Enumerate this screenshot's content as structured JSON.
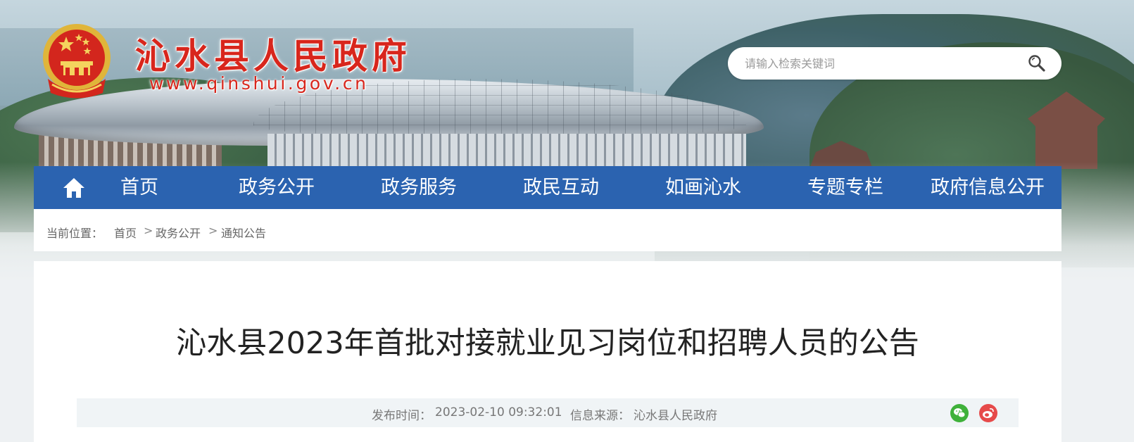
{
  "header": {
    "site_name": "沁水县人民政府",
    "site_url": "www.qinshui.gov.cn"
  },
  "search": {
    "placeholder": "请输入检索关键词",
    "value": ""
  },
  "nav": {
    "home_icon": "home-icon",
    "items": [
      "首页",
      "政务公开",
      "政务服务",
      "政民互动",
      "如画沁水",
      "专题专栏",
      "政府信息公开"
    ]
  },
  "breadcrumb": {
    "label": "当前位置：",
    "items": [
      "首页",
      "政务公开",
      "通知公告"
    ],
    "separator": ">"
  },
  "article": {
    "title": "沁水县2023年首批对接就业见习岗位和招聘人员的公告",
    "publish_label": "发布时间：",
    "publish_time": "2023-02-10 09:32:01",
    "source_label": "信息来源：",
    "source": "沁水县人民政府"
  },
  "share": {
    "icons": [
      "wechat-icon",
      "weibo-icon"
    ]
  },
  "colors": {
    "nav_bg": "#2b63b0",
    "title_red": "#d8261c",
    "wechat": "#3fb13a",
    "weibo": "#e64a4a"
  }
}
